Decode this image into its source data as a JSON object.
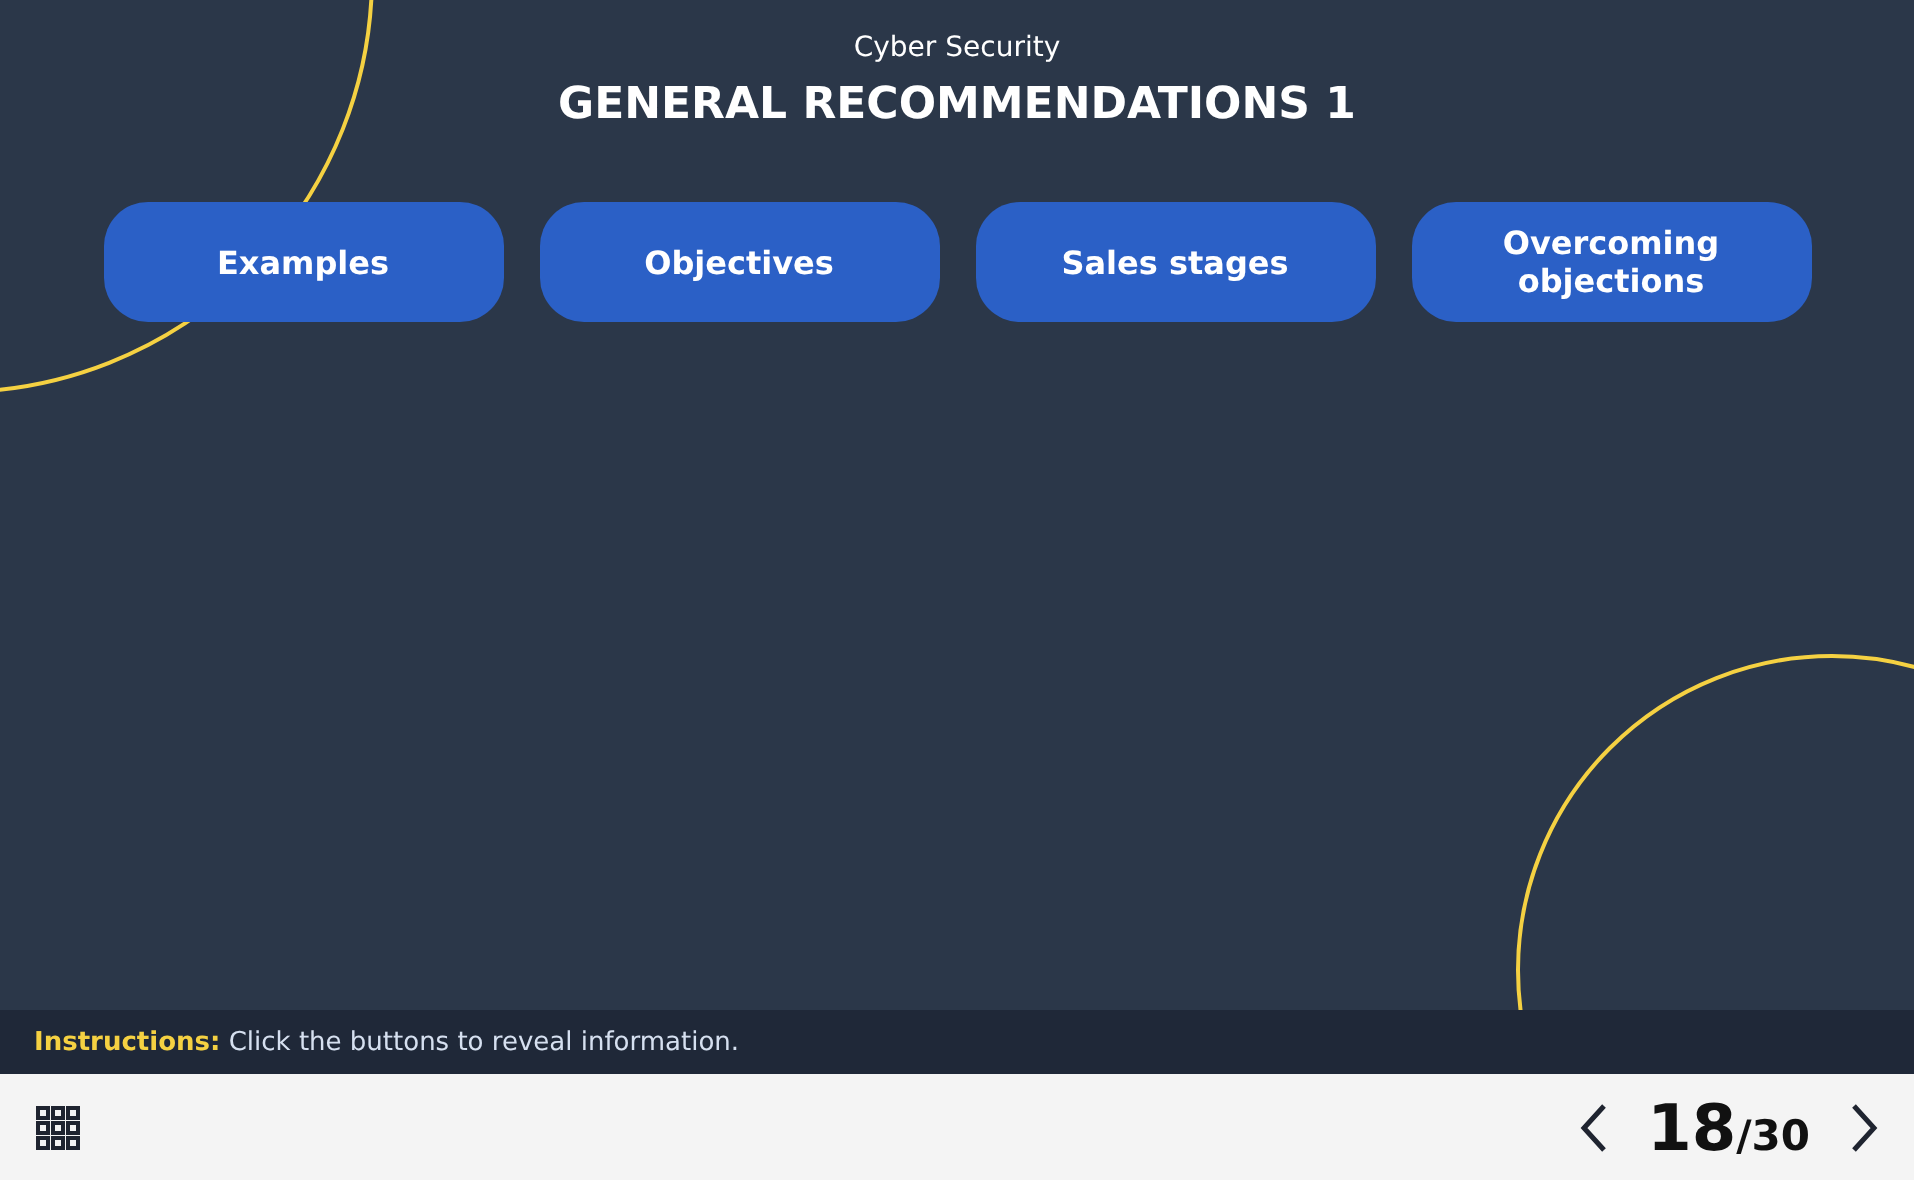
{
  "course": {
    "title": "Cyber Security"
  },
  "slide": {
    "heading": "GENERAL RECOMMENDATIONS 1",
    "buttons": [
      {
        "label": "Examples"
      },
      {
        "label": "Objectives"
      },
      {
        "label": "Sales stages"
      },
      {
        "label": "Overcoming objections"
      }
    ]
  },
  "instructions": "**Instructions:** Click the buttons to reveal information.",
  "footer": {
    "current_page": "18",
    "total_pages": "/30"
  }
}
